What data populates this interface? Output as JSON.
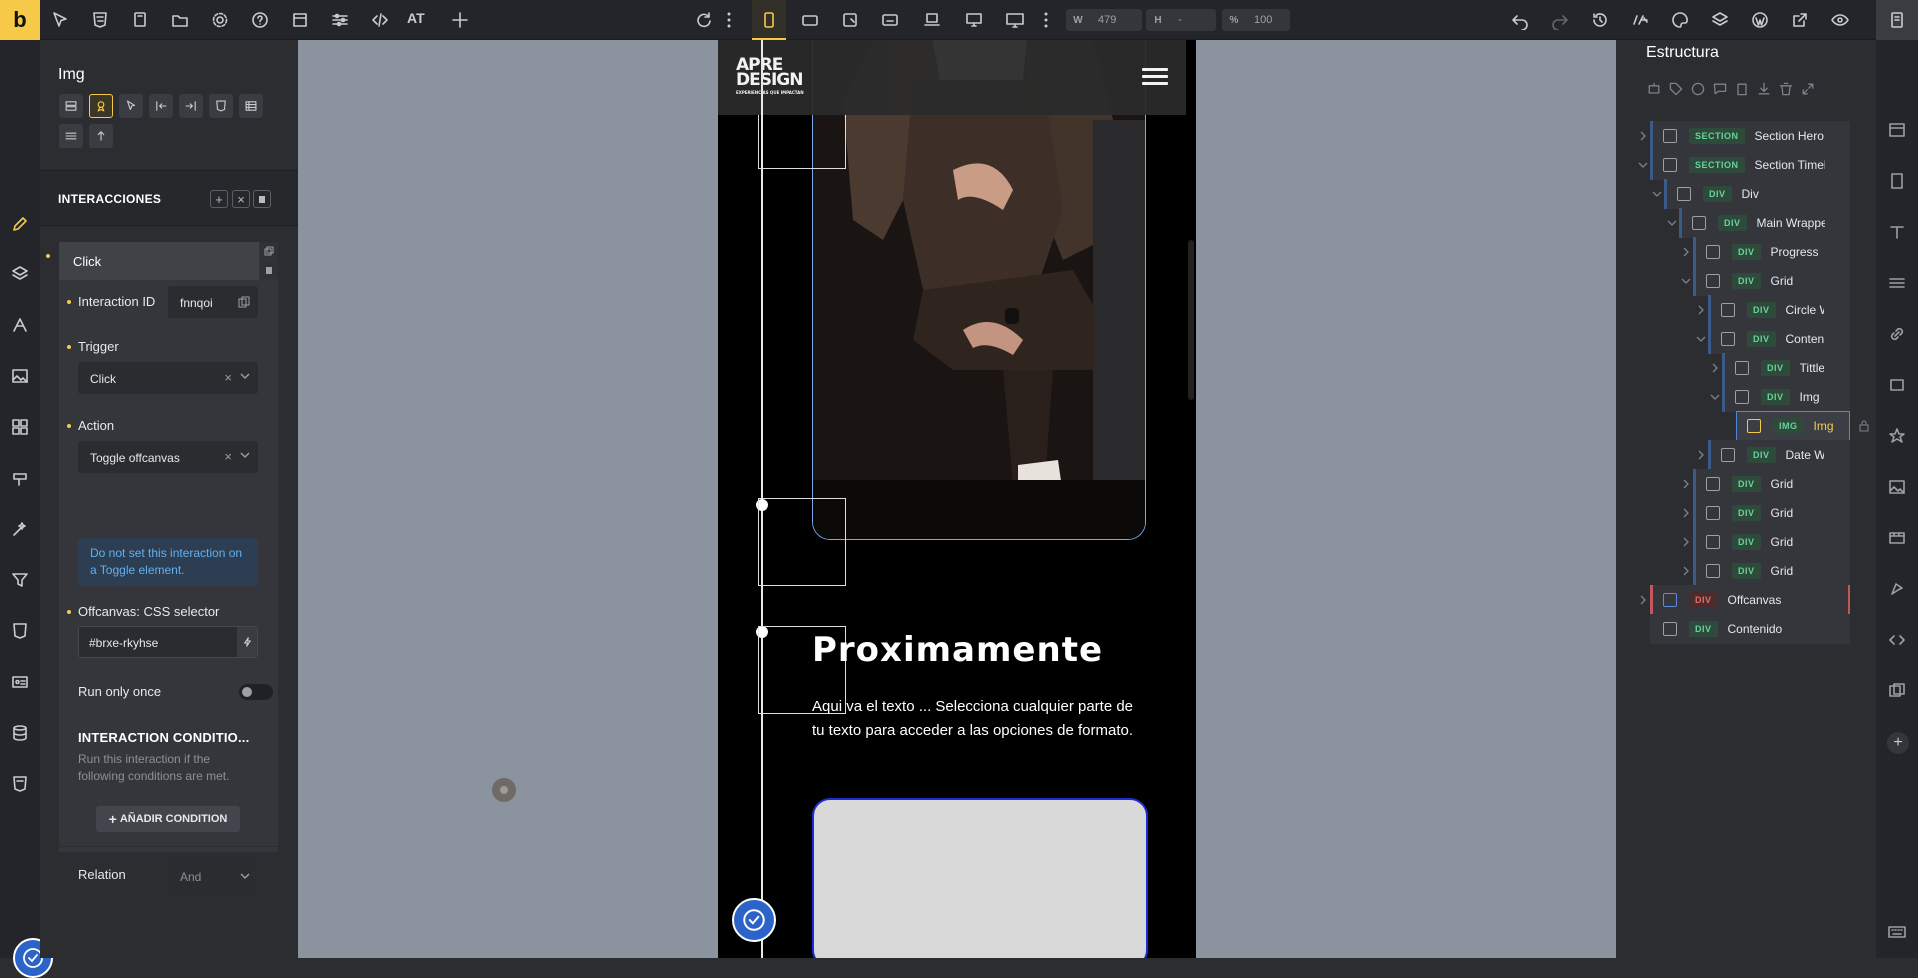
{
  "topbar": {
    "logo": "b",
    "at_label": "AT",
    "width_label": "W",
    "width_value": "479",
    "height_label": "H",
    "height_value": "-",
    "zoom_label": "%",
    "zoom_value": "100"
  },
  "left_panel": {
    "element_title": "Img",
    "section_title": "INTERACCIONES",
    "interaction": {
      "name": "Click",
      "id_label": "Interaction ID",
      "id_value": "fnnqoi",
      "trigger_label": "Trigger",
      "trigger_value": "Click",
      "action_label": "Action",
      "action_value": "Toggle offcanvas",
      "info_text": "Do not set this interaction on a Toggle element.",
      "selector_label": "Offcanvas: CSS selector",
      "selector_value": "#brxe-rkyhse",
      "run_once_label": "Run only once",
      "run_once": false,
      "conditions_title": "INTERACTION CONDITIO...",
      "conditions_text": "Run this interaction if the following conditions are met.",
      "add_condition_label": "AÑADIR CONDITION",
      "relation_label": "Relation",
      "relation_value": "And"
    }
  },
  "preview": {
    "brand_line1": "APRE",
    "brand_line2": "DESIGN",
    "brand_tagline": "EXPERIENCIAS QUE IMPACTAN",
    "heading": "Proximamente",
    "body_text": "Aqui va el texto ... Selecciona cualquier parte de tu texto para acceder a las opciones de formato."
  },
  "structure": {
    "title": "Estructura",
    "nodes": [
      {
        "tag": "SECTION",
        "label": "Section Hero"
      },
      {
        "tag": "SECTION",
        "label": "Section Timeline"
      },
      {
        "tag": "DIV",
        "label": "Div"
      },
      {
        "tag": "DIV",
        "label": "Main Wrapper"
      },
      {
        "tag": "DIV",
        "label": "Progress"
      },
      {
        "tag": "DIV",
        "label": "Grid"
      },
      {
        "tag": "DIV",
        "label": "Circle Wrapper"
      },
      {
        "tag": "DIV",
        "label": "Content"
      },
      {
        "tag": "DIV",
        "label": "Tittle"
      },
      {
        "tag": "DIV",
        "label": "Img"
      },
      {
        "tag": "IMG",
        "label": "Img"
      },
      {
        "tag": "DIV",
        "label": "Date Wrapper"
      },
      {
        "tag": "DIV",
        "label": "Grid"
      },
      {
        "tag": "DIV",
        "label": "Grid"
      },
      {
        "tag": "DIV",
        "label": "Grid"
      },
      {
        "tag": "DIV",
        "label": "Grid"
      },
      {
        "tag": "DIV",
        "label": "Offcanvas"
      },
      {
        "tag": "DIV",
        "label": "Contenido"
      }
    ]
  },
  "colors": {
    "accent": "#f7c948",
    "selection": "#4e86d8",
    "tag_green": "#67d39a",
    "tag_red": "#e86a6a"
  }
}
